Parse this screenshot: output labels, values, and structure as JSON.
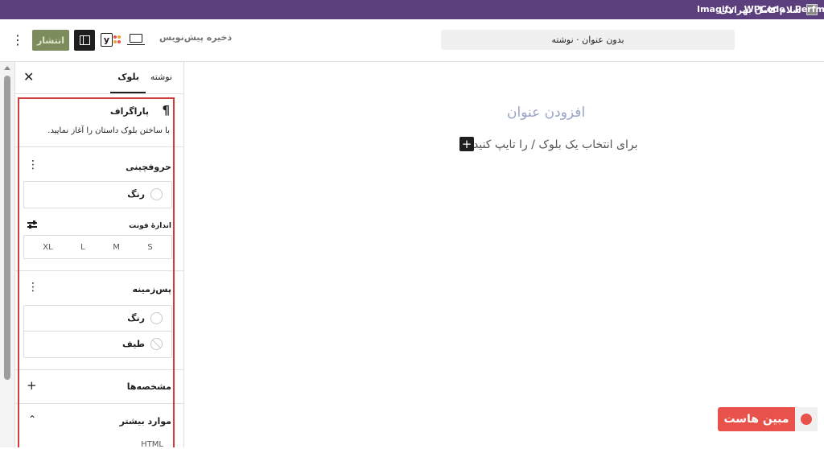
{
  "admin_bar": {
    "greeting": "سلام کامل بهرامی",
    "plugins": [
      "Imagify",
      "WPCode",
      "Perfmatters"
    ]
  },
  "toolbar": {
    "publish_label": "انتشار",
    "save_draft_label": "ذخیره پیش‌نویس",
    "document_title": "بدون عنوان · نوشته",
    "yoast_letter": "y"
  },
  "sidebar": {
    "tabs": {
      "post": "نوشته",
      "block": "بلوک"
    },
    "paragraph": {
      "title": "پاراگراف",
      "description": "با ساختن بلوک داستان را آغاز نمایید."
    },
    "typography": {
      "title": "حروفچینی",
      "color_label": "رنگ",
      "font_size_label": "اندازهٔ فونت",
      "sizes": [
        "XL",
        "L",
        "M",
        "S"
      ]
    },
    "background": {
      "title": "پس‌زمینه",
      "color_label": "رنگ",
      "gradient_label": "طیف"
    },
    "attributes_title": "مشخصه‌ها",
    "more_title": "موارد بیشتر",
    "html_hint": "HTML"
  },
  "canvas": {
    "title_placeholder": "افزودن عنوان",
    "block_prompt": "برای انتخاب یک بلوک / را تایپ کنید"
  },
  "watermark": {
    "text": "مبین هاست"
  },
  "colors": {
    "admin_bar": "#5b3e7c",
    "publish_button": "#7d8c5c",
    "highlight_frame": "#d23b3b",
    "watermark": "#e8524a"
  }
}
